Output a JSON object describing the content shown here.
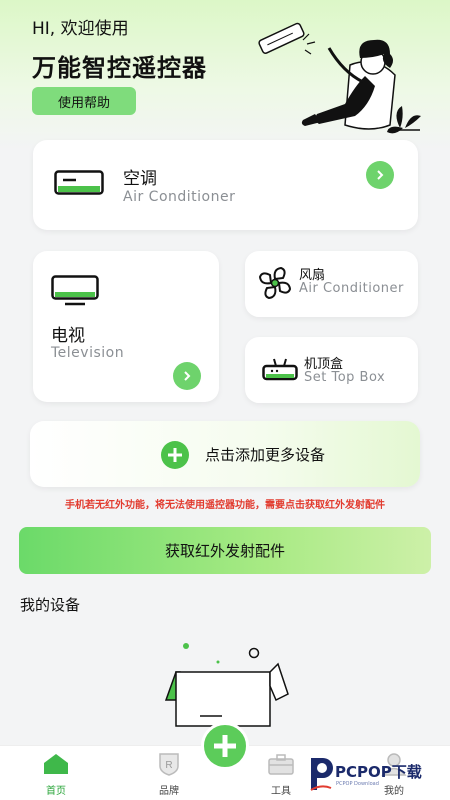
{
  "header": {
    "greeting": "HI, 欢迎使用",
    "title": "万能智控遥控器",
    "help_button": "使用帮助"
  },
  "devices": {
    "air_conditioner": {
      "name": "空调",
      "subtitle": "Air Conditioner"
    },
    "tv": {
      "name": "电视",
      "subtitle": "Television"
    },
    "fan": {
      "name": "风扇",
      "subtitle": "Air Conditioner"
    },
    "set_top_box": {
      "name": "机顶盒",
      "subtitle": "Set Top Box"
    },
    "add_more": "点击添加更多设备"
  },
  "warning": "手机若无红外功能，将无法使用遥控器功能，需要点击获取红外发射配件",
  "get_accessory_button": "获取红外发射配件",
  "my_devices_title": "我的设备",
  "tabbar": {
    "items": [
      {
        "label": "首页",
        "icon": "home-icon",
        "active": true
      },
      {
        "label": "品牌",
        "icon": "brand-shield-icon",
        "active": false
      },
      {
        "label": "工具",
        "icon": "toolbox-icon",
        "active": false
      },
      {
        "label": "我的",
        "icon": "user-icon",
        "active": false
      }
    ]
  },
  "watermark": {
    "brand": "PCPOP下载",
    "small": "PCPOP Download"
  },
  "colors": {
    "accent_green": "#6ed36c",
    "warning_red": "#e23b2f",
    "header_bg": "#dcf7c7"
  }
}
